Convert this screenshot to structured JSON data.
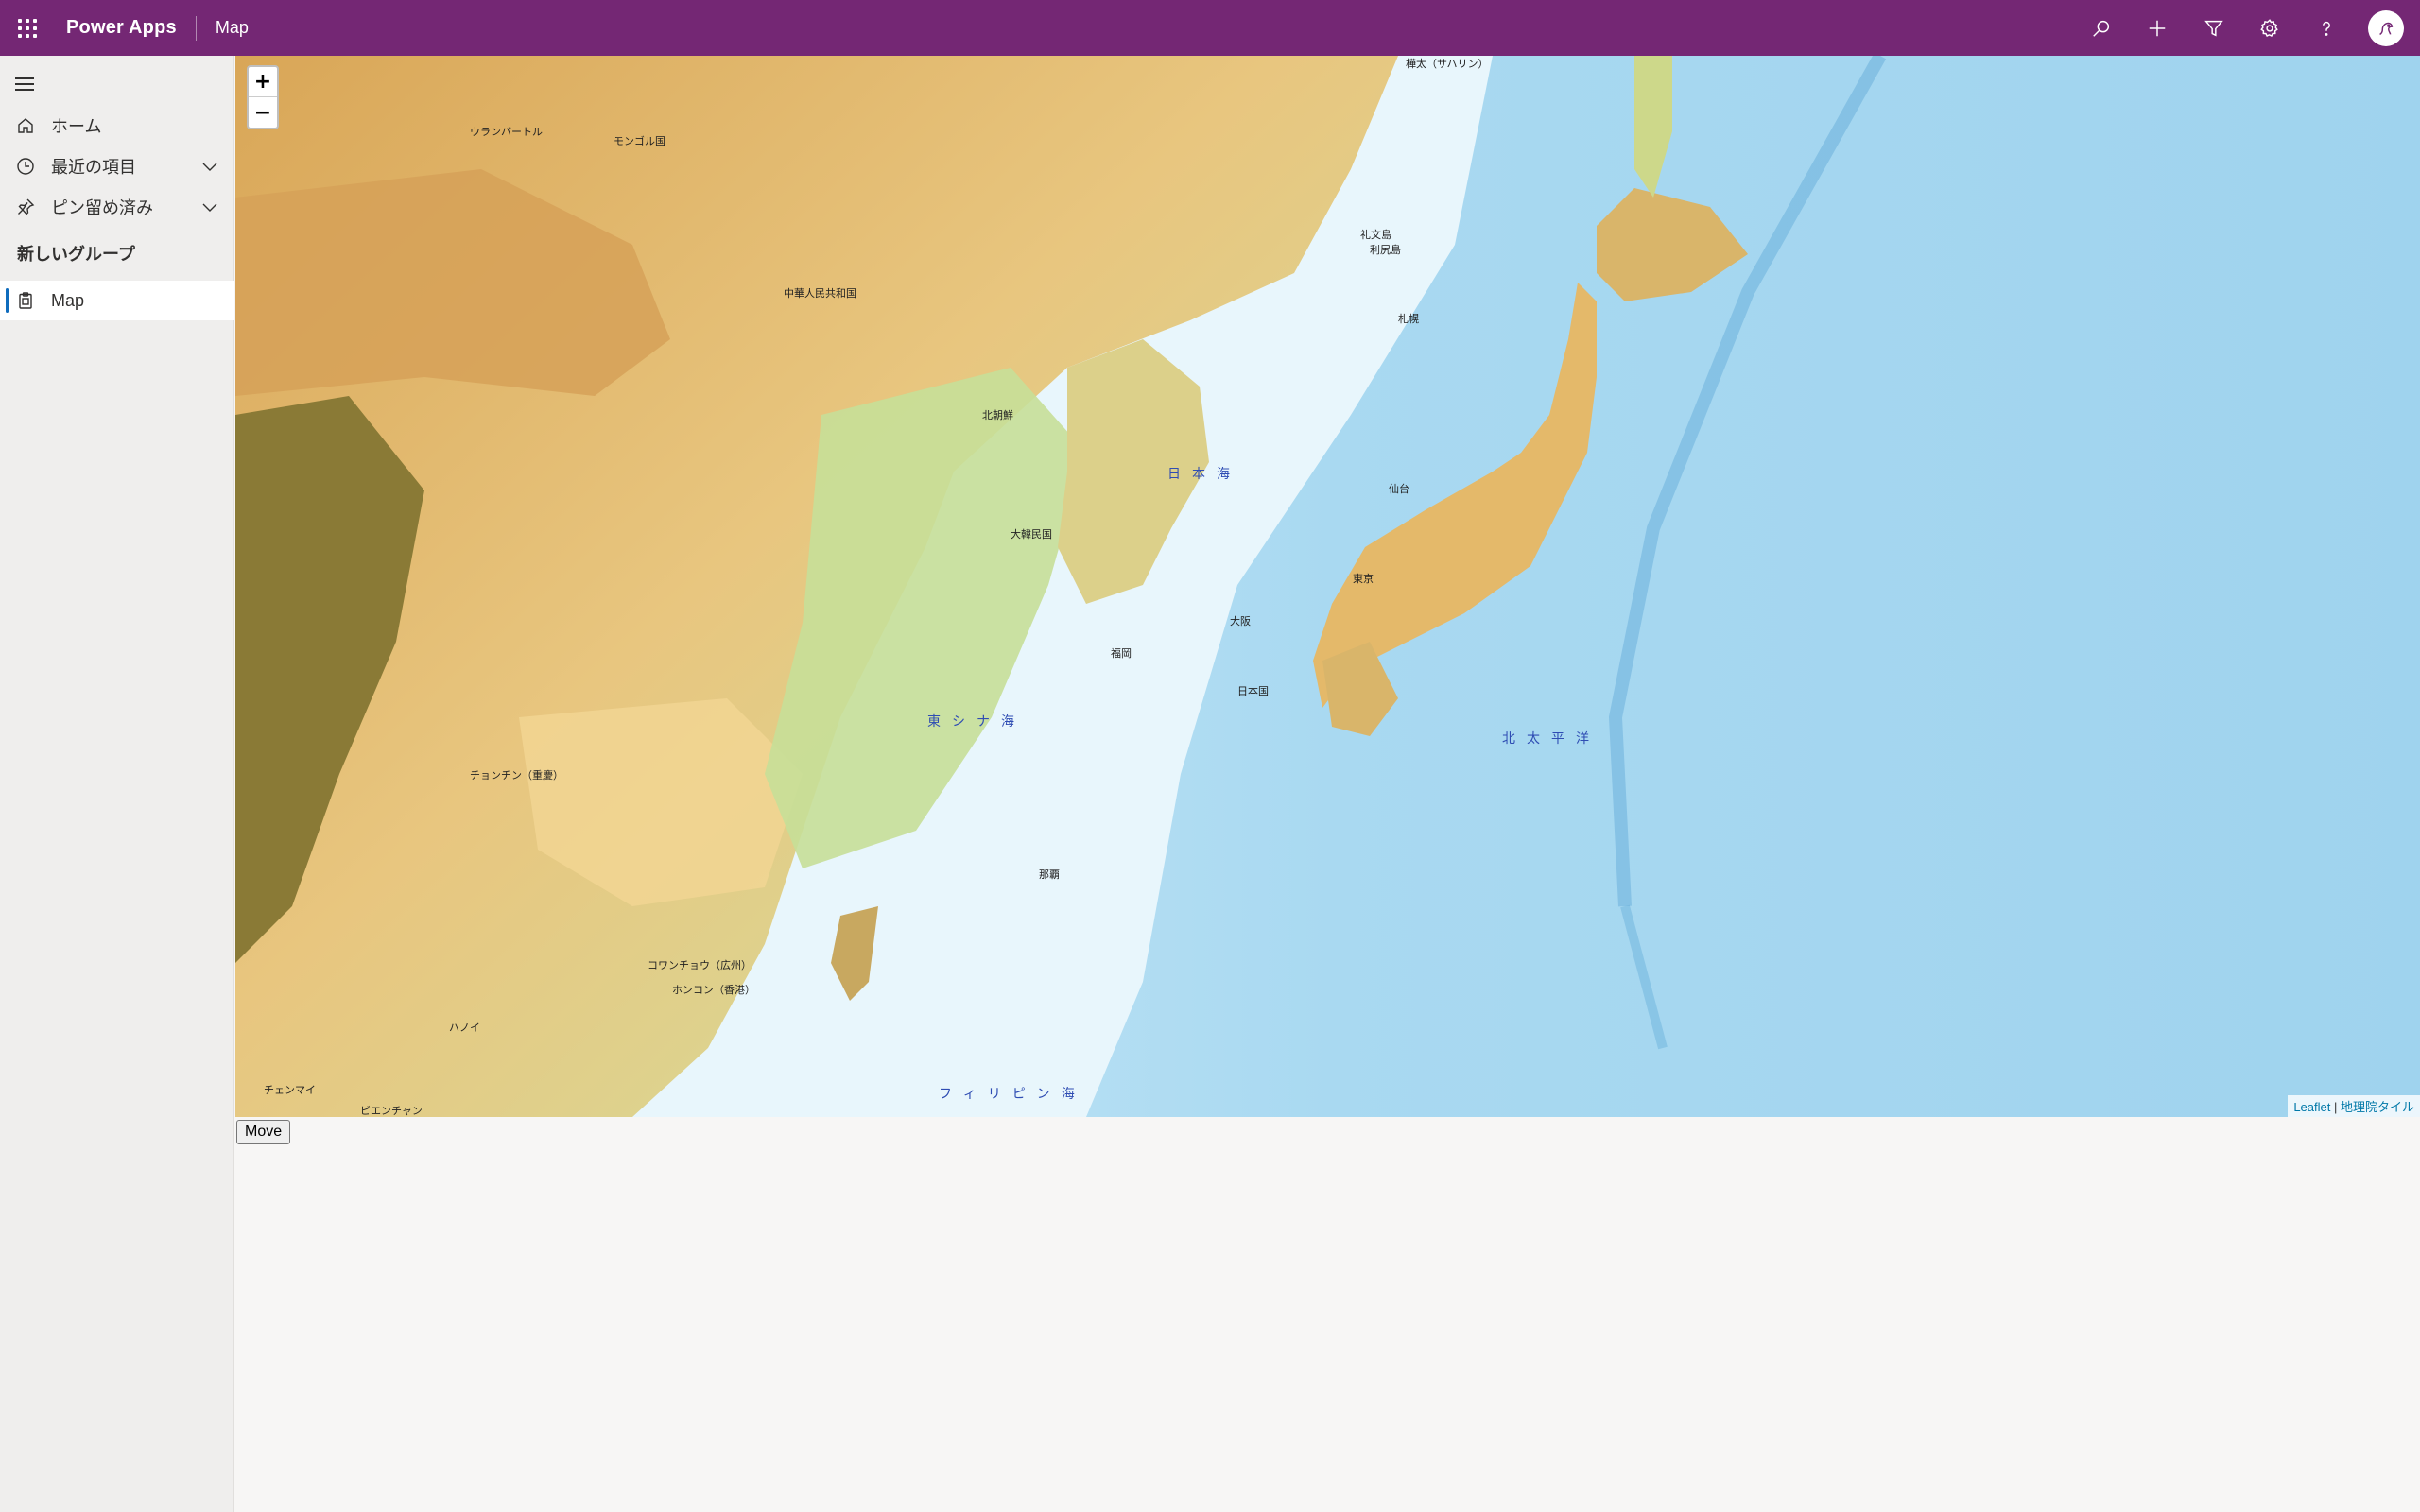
{
  "topbar": {
    "app_name": "Power Apps",
    "page_name": "Map",
    "actions": [
      "search-icon",
      "add-icon",
      "filter-icon",
      "settings-icon",
      "help-icon",
      "avatar"
    ]
  },
  "sidebar": {
    "items": [
      {
        "label": "ホーム",
        "icon": "home-icon"
      },
      {
        "label": "最近の項目",
        "icon": "clock-icon",
        "expandable": true
      },
      {
        "label": "ピン留め済み",
        "icon": "pin-icon",
        "expandable": true
      }
    ],
    "group_title": "新しいグループ",
    "group_items": [
      {
        "label": "Map",
        "icon": "clipboard-icon",
        "selected": true
      }
    ]
  },
  "map": {
    "zoom_in": "+",
    "zoom_out": "−",
    "labels": {
      "ulaanbaatar": "ウランバートル",
      "mongolia": "モンゴル国",
      "china": "中華人民共和国",
      "north_korea": "北朝鮮",
      "south_korea": "大韓民国",
      "chongqing": "チョンチン（重慶）",
      "guangzhou": "コワンチョウ（広州）",
      "hongkong": "ホンコン（香港）",
      "hanoi": "ハノイ",
      "chiang_mai": "チェンマイ",
      "vientiane": "ビエンチャン",
      "sapporo": "札幌",
      "sendai": "仙台",
      "tokyo": "東京",
      "osaka": "大阪",
      "fukuoka": "福岡",
      "naha": "那覇",
      "japan": "日本国",
      "sakhalin": "樺太（サハリン）",
      "rishiri": "利尻島",
      "rebun": "礼文島"
    },
    "seas": {
      "sea_of_japan": "日本海",
      "east_china_sea": "東シナ海",
      "pacific": "北太平洋",
      "philippine_sea": "フィリピン海"
    },
    "attribution": {
      "leaflet": "Leaflet",
      "separator": " | ",
      "gsi": "地理院タイル"
    }
  },
  "move_button": "Move"
}
